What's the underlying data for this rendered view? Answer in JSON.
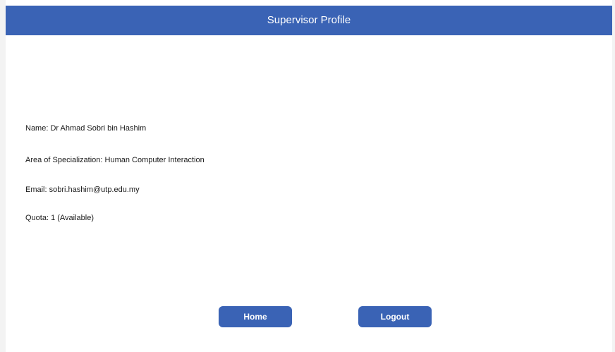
{
  "header": {
    "title": "Supervisor Profile"
  },
  "profile": {
    "name": "Name: Dr Ahmad Sobri bin Hashim",
    "specialization": "Area of Specialization: Human Computer Interaction",
    "email": "Email: sobri.hashim@utp.edu.my",
    "quota": "Quota: 1 (Available)"
  },
  "actions": {
    "home_label": "Home",
    "logout_label": "Logout"
  },
  "colors": {
    "accent": "#3a63b5"
  }
}
